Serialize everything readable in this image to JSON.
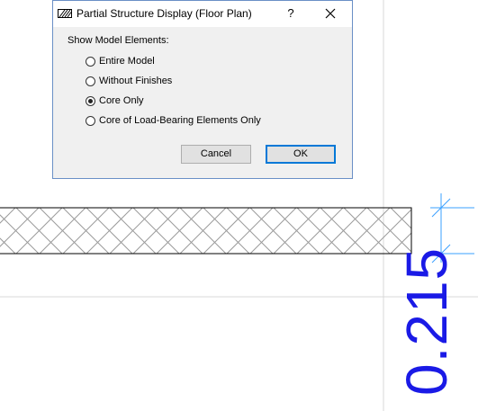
{
  "dialog": {
    "title": "Partial Structure Display (Floor Plan)",
    "help_glyph": "?",
    "group_label": "Show Model Elements:",
    "options": [
      {
        "label": "Entire Model",
        "checked": false
      },
      {
        "label": "Without Finishes",
        "checked": false
      },
      {
        "label": "Core Only",
        "checked": true
      },
      {
        "label": "Core of Load-Bearing Elements Only",
        "checked": false
      }
    ],
    "cancel_label": "Cancel",
    "ok_label": "OK"
  },
  "drawing": {
    "dimension_value": "0.215",
    "dimension_color": "#1a1ae6",
    "hatch_color": "#9a9a9a"
  }
}
